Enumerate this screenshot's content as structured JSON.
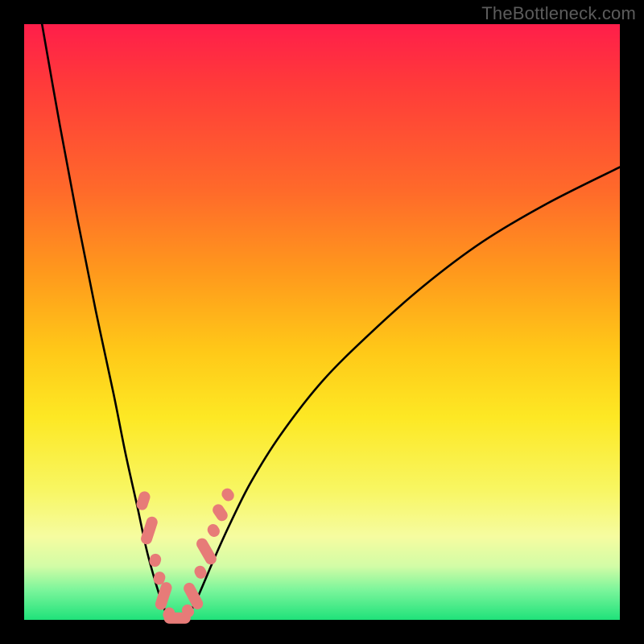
{
  "watermark": "TheBottleneck.com",
  "chart_data": {
    "type": "line",
    "title": "",
    "xlabel": "",
    "ylabel": "",
    "xlim": [
      0,
      100
    ],
    "ylim": [
      0,
      100
    ],
    "series": [
      {
        "name": "curve-left-branch",
        "x": [
          3,
          6,
          9,
          12,
          15,
          17,
          19,
          20.5,
          21.7,
          22.6,
          23.3,
          23.8,
          24.3
        ],
        "values": [
          100,
          83,
          67,
          52,
          38,
          28,
          19,
          12,
          7.5,
          4.5,
          2.5,
          1.2,
          0.3
        ]
      },
      {
        "name": "curve-right-branch",
        "x": [
          27.2,
          28,
          29,
          30.3,
          32,
          34.5,
          38,
          43,
          50,
          58,
          67,
          77,
          88,
          100
        ],
        "values": [
          0.3,
          1.5,
          3.5,
          6.5,
          10.5,
          16,
          23,
          31,
          40,
          48,
          56,
          63.5,
          70,
          76
        ]
      }
    ],
    "markers": [
      {
        "name": "beads-left",
        "style": "pill",
        "color": "#e77b78",
        "points": [
          {
            "x": 20.0,
            "y": 20.0,
            "len": 3.2,
            "ang": -72
          },
          {
            "x": 21.0,
            "y": 15.0,
            "len": 4.8,
            "ang": -72
          },
          {
            "x": 22.0,
            "y": 10.0,
            "len": 2.2,
            "ang": -72
          },
          {
            "x": 22.7,
            "y": 7.0,
            "len": 2.2,
            "ang": -72
          },
          {
            "x": 23.4,
            "y": 4.0,
            "len": 4.8,
            "ang": -72
          },
          {
            "x": 24.3,
            "y": 1.0,
            "len": 2.2,
            "ang": -68
          }
        ]
      },
      {
        "name": "beads-bottom",
        "style": "pill",
        "color": "#e77b78",
        "points": [
          {
            "x": 25.7,
            "y": 0.3,
            "len": 4.5,
            "ang": 0
          }
        ]
      },
      {
        "name": "beads-right",
        "style": "pill",
        "color": "#e77b78",
        "points": [
          {
            "x": 27.5,
            "y": 1.5,
            "len": 2.2,
            "ang": 60
          },
          {
            "x": 28.4,
            "y": 4.0,
            "len": 4.8,
            "ang": 62
          },
          {
            "x": 29.6,
            "y": 8.0,
            "len": 2.2,
            "ang": 62
          },
          {
            "x": 30.6,
            "y": 11.5,
            "len": 4.8,
            "ang": 60
          },
          {
            "x": 31.8,
            "y": 15.0,
            "len": 2.2,
            "ang": 58
          },
          {
            "x": 32.9,
            "y": 18.0,
            "len": 3.0,
            "ang": 56
          },
          {
            "x": 34.2,
            "y": 21.0,
            "len": 2.2,
            "ang": 54
          }
        ]
      }
    ]
  }
}
